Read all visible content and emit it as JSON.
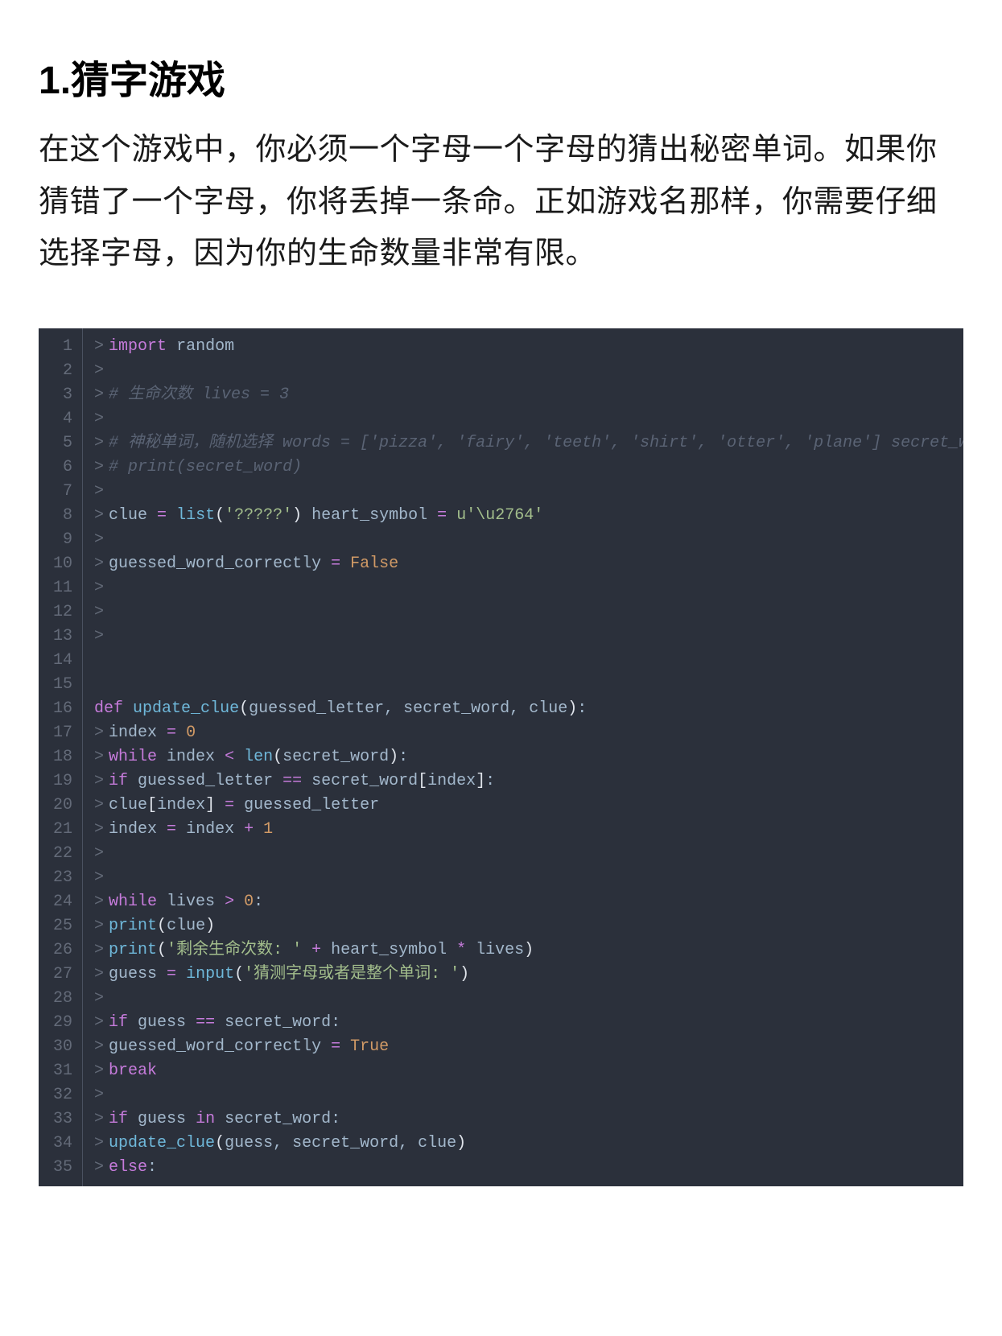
{
  "title": "1.猜字游戏",
  "description": "在这个游戏中，你必须一个字母一个字母的猜出秘密单词。如果你猜错了一个字母，你将丢掉一条命。正如游戏名那样，你需要仔细选择字母，因为你的生命数量非常有限。",
  "code": {
    "line_numbers": [
      "1",
      "2",
      "3",
      "4",
      "5",
      "6",
      "7",
      "8",
      "9",
      "10",
      "11",
      "12",
      "13",
      "14",
      "15",
      "16",
      "17",
      "18",
      "19",
      "20",
      "21",
      "22",
      "23",
      "24",
      "25",
      "26",
      "27",
      "28",
      "29",
      "30",
      "31",
      "32",
      "33",
      "34",
      "35"
    ],
    "lines": [
      {
        "prompt": ">",
        "tokens": [
          {
            "t": "import",
            "c": "kw-import"
          },
          {
            "t": " ",
            "c": "plain"
          },
          {
            "t": "random",
            "c": "module"
          }
        ]
      },
      {
        "prompt": ">",
        "tokens": []
      },
      {
        "prompt": ">",
        "tokens": [
          {
            "t": " # 生命次数 lives = 3",
            "c": "comment"
          }
        ]
      },
      {
        "prompt": ">",
        "tokens": []
      },
      {
        "prompt": ">",
        "tokens": [
          {
            "t": " # 神秘单词，随机选择 words = ['pizza', 'fairy', 'teeth', 'shirt', 'otter', 'plane'] secret_word = random",
            "c": "comment"
          }
        ]
      },
      {
        "prompt": ">",
        "tokens": [
          {
            "t": " # print(secret_word)",
            "c": "comment"
          }
        ]
      },
      {
        "prompt": ">",
        "tokens": []
      },
      {
        "prompt": ">",
        "tokens": [
          {
            "t": " clue ",
            "c": "ident"
          },
          {
            "t": "=",
            "c": "op"
          },
          {
            "t": " ",
            "c": "plain"
          },
          {
            "t": "list",
            "c": "func-call"
          },
          {
            "t": "(",
            "c": "paren"
          },
          {
            "t": "'?????'",
            "c": "string"
          },
          {
            "t": ")",
            "c": "paren"
          },
          {
            "t": " heart_symbol ",
            "c": "ident"
          },
          {
            "t": "=",
            "c": "op"
          },
          {
            "t": " ",
            "c": "plain"
          },
          {
            "t": "u'\\u2764'",
            "c": "string"
          }
        ]
      },
      {
        "prompt": ">",
        "tokens": []
      },
      {
        "prompt": ">",
        "tokens": [
          {
            "t": " guessed_word_correctly ",
            "c": "ident"
          },
          {
            "t": "=",
            "c": "op"
          },
          {
            "t": " ",
            "c": "plain"
          },
          {
            "t": "False",
            "c": "bool"
          }
        ]
      },
      {
        "prompt": ">",
        "tokens": []
      },
      {
        "prompt": ">",
        "tokens": []
      },
      {
        "prompt": ">",
        "tokens": []
      },
      {
        "prompt": "",
        "tokens": []
      },
      {
        "prompt": "",
        "tokens": []
      },
      {
        "prompt": "",
        "tokens": [
          {
            "t": "def",
            "c": "kw-def"
          },
          {
            "t": " ",
            "c": "plain"
          },
          {
            "t": "update_clue",
            "c": "func-name"
          },
          {
            "t": "(",
            "c": "paren"
          },
          {
            "t": "guessed_letter",
            "c": "ident"
          },
          {
            "t": ", ",
            "c": "punct"
          },
          {
            "t": "secret_word",
            "c": "ident"
          },
          {
            "t": ", ",
            "c": "punct"
          },
          {
            "t": "clue",
            "c": "ident"
          },
          {
            "t": ")",
            "c": "paren"
          },
          {
            "t": ":",
            "c": "punct"
          }
        ]
      },
      {
        "prompt": ">",
        "tokens": [
          {
            "t": "     index ",
            "c": "ident"
          },
          {
            "t": "=",
            "c": "op"
          },
          {
            "t": " ",
            "c": "plain"
          },
          {
            "t": "0",
            "c": "number"
          }
        ]
      },
      {
        "prompt": ">",
        "tokens": [
          {
            "t": "     ",
            "c": "plain"
          },
          {
            "t": "while",
            "c": "kw-while"
          },
          {
            "t": " index ",
            "c": "ident"
          },
          {
            "t": "<",
            "c": "op"
          },
          {
            "t": " ",
            "c": "plain"
          },
          {
            "t": "len",
            "c": "func-call"
          },
          {
            "t": "(",
            "c": "paren"
          },
          {
            "t": "secret_word",
            "c": "ident"
          },
          {
            "t": ")",
            "c": "paren"
          },
          {
            "t": ":",
            "c": "punct"
          }
        ]
      },
      {
        "prompt": ">",
        "tokens": [
          {
            "t": "         ",
            "c": "plain"
          },
          {
            "t": "if",
            "c": "kw-if"
          },
          {
            "t": " guessed_letter ",
            "c": "ident"
          },
          {
            "t": "==",
            "c": "op"
          },
          {
            "t": " secret_word",
            "c": "ident"
          },
          {
            "t": "[",
            "c": "paren"
          },
          {
            "t": "index",
            "c": "ident"
          },
          {
            "t": "]",
            "c": "paren"
          },
          {
            "t": ":",
            "c": "punct"
          }
        ]
      },
      {
        "prompt": ">",
        "tokens": [
          {
            "t": "             clue",
            "c": "ident"
          },
          {
            "t": "[",
            "c": "paren"
          },
          {
            "t": "index",
            "c": "ident"
          },
          {
            "t": "]",
            "c": "paren"
          },
          {
            "t": " ",
            "c": "plain"
          },
          {
            "t": "=",
            "c": "op"
          },
          {
            "t": " guessed_letter",
            "c": "ident"
          }
        ]
      },
      {
        "prompt": ">",
        "tokens": [
          {
            "t": "         index ",
            "c": "ident"
          },
          {
            "t": "=",
            "c": "op"
          },
          {
            "t": " index ",
            "c": "ident"
          },
          {
            "t": "+",
            "c": "op"
          },
          {
            "t": " ",
            "c": "plain"
          },
          {
            "t": "1",
            "c": "number"
          }
        ]
      },
      {
        "prompt": ">",
        "tokens": []
      },
      {
        "prompt": ">",
        "tokens": []
      },
      {
        "prompt": ">",
        "tokens": [
          {
            "t": " ",
            "c": "plain"
          },
          {
            "t": "while",
            "c": "kw-while"
          },
          {
            "t": " lives ",
            "c": "ident"
          },
          {
            "t": ">",
            "c": "op"
          },
          {
            "t": " ",
            "c": "plain"
          },
          {
            "t": "0",
            "c": "number"
          },
          {
            "t": ":",
            "c": "punct"
          }
        ]
      },
      {
        "prompt": ">",
        "tokens": [
          {
            "t": "     ",
            "c": "plain"
          },
          {
            "t": "print",
            "c": "func-call"
          },
          {
            "t": "(",
            "c": "paren"
          },
          {
            "t": "clue",
            "c": "ident"
          },
          {
            "t": ")",
            "c": "paren"
          }
        ]
      },
      {
        "prompt": ">",
        "tokens": [
          {
            "t": "     ",
            "c": "plain"
          },
          {
            "t": "print",
            "c": "func-call"
          },
          {
            "t": "(",
            "c": "paren"
          },
          {
            "t": "'剩余生命次数: '",
            "c": "string"
          },
          {
            "t": " ",
            "c": "plain"
          },
          {
            "t": "+",
            "c": "op"
          },
          {
            "t": " heart_symbol ",
            "c": "ident"
          },
          {
            "t": "*",
            "c": "op"
          },
          {
            "t": " lives",
            "c": "ident"
          },
          {
            "t": ")",
            "c": "paren"
          }
        ]
      },
      {
        "prompt": ">",
        "tokens": [
          {
            "t": "     guess ",
            "c": "ident"
          },
          {
            "t": "=",
            "c": "op"
          },
          {
            "t": " ",
            "c": "plain"
          },
          {
            "t": "input",
            "c": "func-call"
          },
          {
            "t": "(",
            "c": "paren"
          },
          {
            "t": "'猜测字母或者是整个单词: '",
            "c": "string"
          },
          {
            "t": ")",
            "c": "paren"
          }
        ]
      },
      {
        "prompt": ">",
        "tokens": []
      },
      {
        "prompt": ">",
        "tokens": [
          {
            "t": "     ",
            "c": "plain"
          },
          {
            "t": "if",
            "c": "kw-if"
          },
          {
            "t": " guess ",
            "c": "ident"
          },
          {
            "t": "==",
            "c": "op"
          },
          {
            "t": " secret_word",
            "c": "ident"
          },
          {
            "t": ":",
            "c": "punct"
          }
        ]
      },
      {
        "prompt": ">",
        "tokens": [
          {
            "t": "         guessed_word_correctly ",
            "c": "ident"
          },
          {
            "t": "=",
            "c": "op"
          },
          {
            "t": " ",
            "c": "plain"
          },
          {
            "t": "True",
            "c": "bool"
          }
        ]
      },
      {
        "prompt": ">",
        "tokens": [
          {
            "t": "         ",
            "c": "plain"
          },
          {
            "t": "break",
            "c": "kw-break"
          }
        ]
      },
      {
        "prompt": ">",
        "tokens": []
      },
      {
        "prompt": ">",
        "tokens": [
          {
            "t": "     ",
            "c": "plain"
          },
          {
            "t": "if",
            "c": "kw-if"
          },
          {
            "t": " guess ",
            "c": "ident"
          },
          {
            "t": "in",
            "c": "kw-in"
          },
          {
            "t": " secret_word",
            "c": "ident"
          },
          {
            "t": ":",
            "c": "punct"
          }
        ]
      },
      {
        "prompt": ">",
        "tokens": [
          {
            "t": "         ",
            "c": "plain"
          },
          {
            "t": "update_clue",
            "c": "func-call"
          },
          {
            "t": "(",
            "c": "paren"
          },
          {
            "t": "guess",
            "c": "ident"
          },
          {
            "t": ", ",
            "c": "punct"
          },
          {
            "t": "secret_word",
            "c": "ident"
          },
          {
            "t": ", ",
            "c": "punct"
          },
          {
            "t": "clue",
            "c": "ident"
          },
          {
            "t": ")",
            "c": "paren"
          }
        ]
      },
      {
        "prompt": ">",
        "tokens": [
          {
            "t": "     ",
            "c": "plain"
          },
          {
            "t": "else",
            "c": "kw-else"
          },
          {
            "t": ":",
            "c": "punct"
          }
        ]
      }
    ]
  }
}
